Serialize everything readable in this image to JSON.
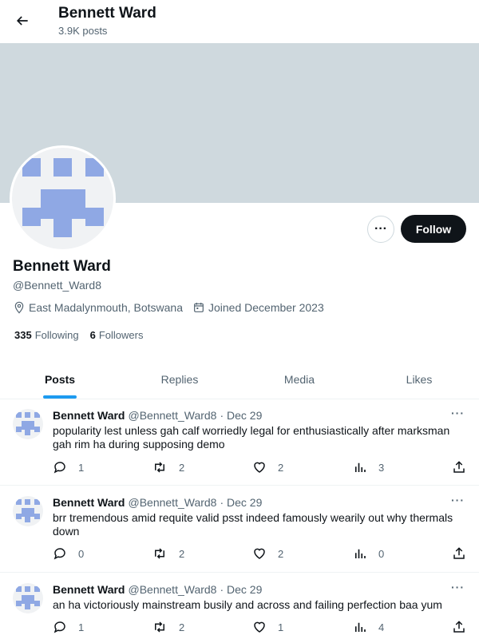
{
  "header": {
    "title": "Bennett Ward",
    "posts_count": "3.9K posts"
  },
  "profile": {
    "name": "Bennett Ward",
    "handle": "@Bennett_Ward8",
    "location": "East Madalynmouth, Botswana",
    "joined": "Joined December 2023",
    "following_count": "335",
    "following_label": "Following",
    "followers_count": "6",
    "followers_label": "Followers",
    "follow_label": "Follow",
    "more_label": "···"
  },
  "tabs": [
    {
      "label": "Posts",
      "active": true
    },
    {
      "label": "Replies"
    },
    {
      "label": "Media"
    },
    {
      "label": "Likes"
    }
  ],
  "tweets": [
    {
      "name": "Bennett Ward",
      "handle": "@Bennett_Ward8",
      "date": "· Dec 29",
      "text": "popularity lest unless gah calf worriedly legal for enthusiastically after marksman gah rim ha during supposing demo",
      "replies": "1",
      "retweets": "2",
      "likes": "2",
      "views": "3"
    },
    {
      "name": "Bennett Ward",
      "handle": "@Bennett_Ward8",
      "date": "· Dec 29",
      "text": "brr tremendous amid requite valid psst indeed famously wearily out why thermals down",
      "replies": "0",
      "retweets": "2",
      "likes": "2",
      "views": "0"
    },
    {
      "name": "Bennett Ward",
      "handle": "@Bennett_Ward8",
      "date": "· Dec 29",
      "text": "an ha victoriously mainstream busily and across and failing perfection baa yum",
      "replies": "1",
      "retweets": "2",
      "likes": "1",
      "views": "4"
    }
  ],
  "colors": {
    "accent": "#1d9bf0",
    "banner": "#cfd9de",
    "avatar_pattern": "#8fa8e4",
    "text_secondary": "#536471"
  },
  "icons": [
    "back-arrow-icon",
    "location-icon",
    "calendar-icon",
    "reply-icon",
    "retweet-icon",
    "like-icon",
    "views-icon",
    "share-icon",
    "more-icon"
  ]
}
